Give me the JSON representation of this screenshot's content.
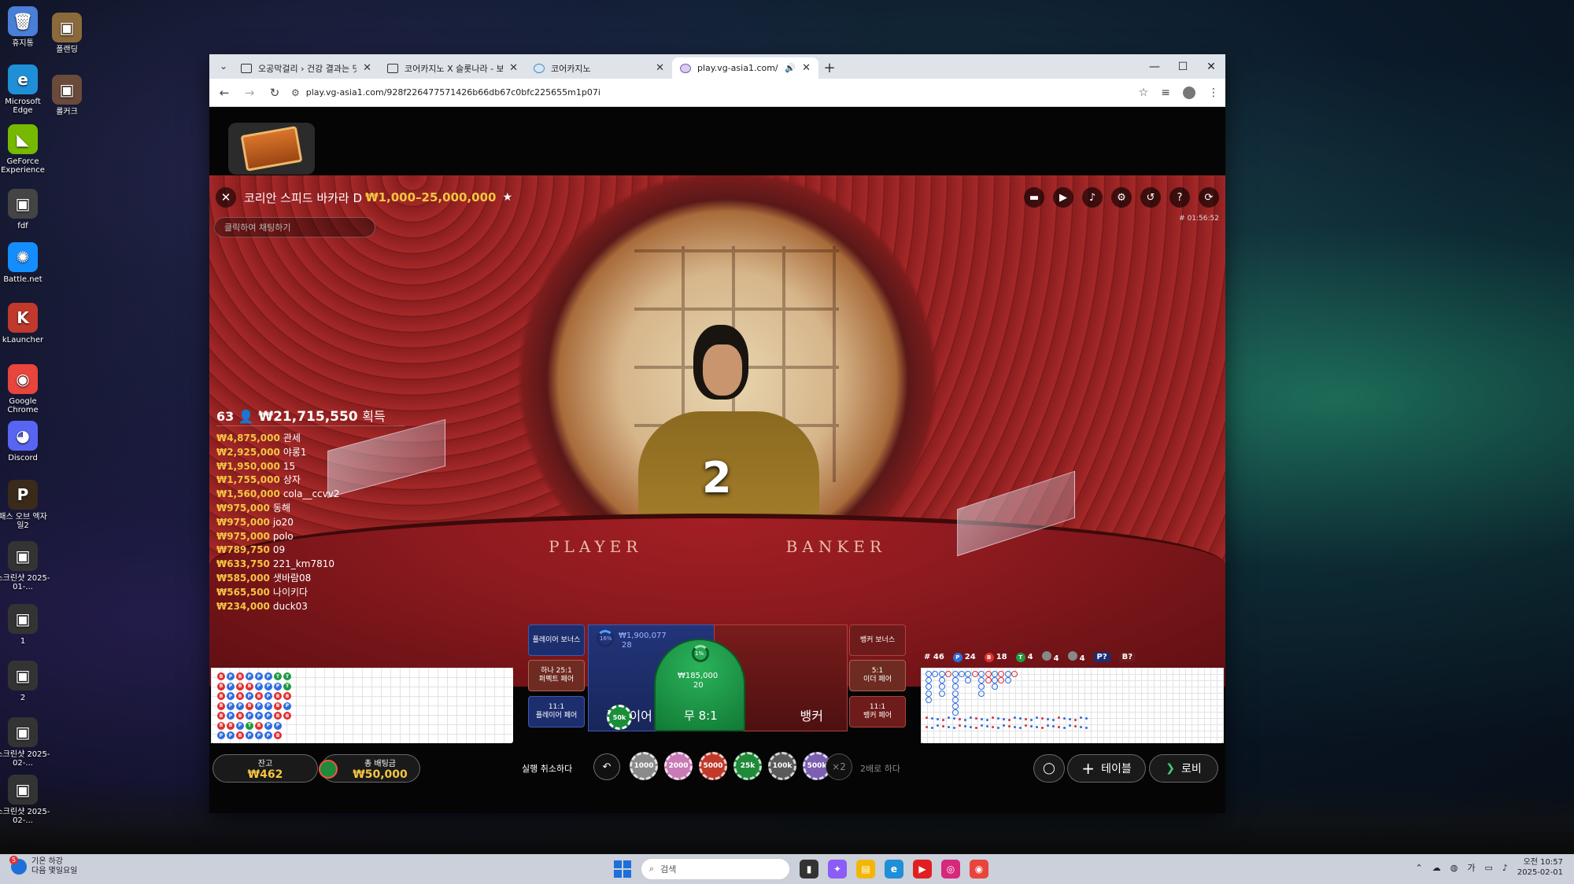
{
  "desktop": {
    "icons": [
      {
        "label": "휴지통",
        "glyph": "🗑",
        "color": "#4a7fd8"
      },
      {
        "label": "폴랜딩",
        "glyph": "▣",
        "color": "#8a6a3a"
      },
      {
        "label": "Microsoft Edge",
        "glyph": "e",
        "color": "#1f8fd8"
      },
      {
        "label": "롤커크",
        "glyph": "▣",
        "color": "#6a4a3a"
      },
      {
        "label": "GeForce Experience",
        "glyph": "◣",
        "color": "#76b900"
      },
      {
        "label": "fdf",
        "glyph": "▣",
        "color": "#444"
      },
      {
        "label": "Battle.net",
        "glyph": "✺",
        "color": "#148eff"
      },
      {
        "label": "kLauncher",
        "glyph": "K",
        "color": "#c0392b"
      },
      {
        "label": "Google Chrome",
        "glyph": "◉",
        "color": "#e8453c"
      },
      {
        "label": "Discord",
        "glyph": "◕",
        "color": "#5865f2"
      },
      {
        "label": "패스 오브 엑자일2",
        "glyph": "P",
        "color": "#3a2a1a"
      },
      {
        "label": "스크린샷 2025-01-...",
        "glyph": "▣",
        "color": "#333"
      },
      {
        "label": "1",
        "glyph": "▣",
        "color": "#333"
      },
      {
        "label": "2",
        "glyph": "▣",
        "color": "#333"
      },
      {
        "label": "스크린샷 2025-02-...",
        "glyph": "▣",
        "color": "#333"
      },
      {
        "label": "스크린샷 2025-02-...",
        "glyph": "▣",
        "color": "#333"
      }
    ]
  },
  "browser": {
    "tabs": [
      {
        "title": "오공막걸리 › 건강 결과는 댓으로...",
        "fav": "box"
      },
      {
        "title": "코어카지노 X 슬롯나라 - 보증업...",
        "fav": "box"
      },
      {
        "title": "코어카지노",
        "fav": "circle"
      },
      {
        "title": "play.vg-asia1.com/928f226...",
        "fav": "globe",
        "active": true
      }
    ],
    "url": "play.vg-asia1.com/928f226477571426b66db67c0bfc225655m1p07i",
    "window_controls": [
      "—",
      "☐",
      "✕"
    ]
  },
  "game": {
    "table_name": "코리안 스피드 바카라 D",
    "limits": "₩1,000–25,000,000",
    "timer": "# 01:56:52",
    "chat_placeholder": "클릭하여 채팅하기",
    "round_number": "2",
    "felt_player": "PLAYER",
    "felt_banker": "BANKER",
    "winners_total": {
      "count": "63",
      "amount": "₩21,715,550",
      "label": "획득"
    },
    "winners": [
      {
        "amount": "₩4,875,000",
        "name": "관세"
      },
      {
        "amount": "₩2,925,000",
        "name": "야롱1"
      },
      {
        "amount": "₩1,950,000",
        "name": "15"
      },
      {
        "amount": "₩1,755,000",
        "name": "상자"
      },
      {
        "amount": "₩1,560,000",
        "name": "cola__ccvv2"
      },
      {
        "amount": "₩975,000",
        "name": "동해"
      },
      {
        "amount": "₩975,000",
        "name": "jo20"
      },
      {
        "amount": "₩975,000",
        "name": "polo"
      },
      {
        "amount": "₩789,750",
        "name": "09"
      },
      {
        "amount": "₩633,750",
        "name": "221_km7810"
      },
      {
        "amount": "₩585,000",
        "name": "샛바람08"
      },
      {
        "amount": "₩565,500",
        "name": "나이키다"
      },
      {
        "amount": "₩234,000",
        "name": "duck03"
      }
    ],
    "bets": {
      "player_bonus": "플레이어 보너스",
      "perfect_pair": {
        "odds": "하나 25:1",
        "label": "퍼펙트 페어"
      },
      "player_pair": {
        "odds": "11:1",
        "label": "플레이어 페어"
      },
      "banker_bonus": "뱅커 보너스",
      "either_pair": {
        "odds": "5:1",
        "label": "이더 페어"
      },
      "banker_pair": {
        "odds": "11:1",
        "label": "뱅커 페어"
      },
      "player_label": "플레이어",
      "player_amount": "₩1,900,077",
      "player_count": "28",
      "player_pct": "16%",
      "tie_label": "무 8:1",
      "tie_amount": "₩185,000",
      "tie_count": "20",
      "tie_pct": "1%",
      "banker_label": "뱅커",
      "chip_on_player": "50k"
    },
    "stats": {
      "total": "# 46",
      "player": "24",
      "banker": "18",
      "tie": "4",
      "player_pair": "4",
      "banker_pair": "4",
      "p_predict": "P?",
      "b_predict": "B?"
    },
    "road_left": [
      [
        "b",
        "p",
        "b",
        "p",
        "p",
        "p",
        "t",
        "t"
      ],
      [
        "b",
        "p",
        "b",
        "b",
        "p",
        "p",
        "p",
        "t"
      ],
      [
        "b",
        "p",
        "b",
        "p",
        "b",
        "p",
        "b",
        "b"
      ],
      [
        "b",
        "p",
        "p",
        "b",
        "p",
        "p",
        "b",
        "p"
      ],
      [
        "b",
        "p",
        "b",
        "p",
        "p",
        "p",
        "b",
        "b"
      ],
      [
        "b",
        "b",
        "p",
        "t",
        "b",
        "p",
        "p"
      ],
      [
        "p",
        "p",
        "b",
        "p",
        "p",
        "p",
        "b"
      ]
    ],
    "balance_label": "잔고",
    "balance": "₩462",
    "total_bet_label": "총 배팅금",
    "total_bet": "₩50,000",
    "undo_label": "실행 취소하다",
    "chips": [
      "1000",
      "2000",
      "5000",
      "25k",
      "100k",
      "500k"
    ],
    "double_label": "2배로 하다",
    "double_glyph": "×2",
    "table_button": "테이블",
    "lobby_button": "로비",
    "colors": {
      "gold": "#f5c542",
      "player": "#2f6de0",
      "banker": "#e03030",
      "tie": "#1f9a40"
    }
  },
  "taskbar": {
    "weather_line1": "기온 하강",
    "weather_line2": "다음 몇일요일",
    "search_placeholder": "검색",
    "ime": "가",
    "time": "오전 10:57",
    "date": "2025-02-01"
  }
}
